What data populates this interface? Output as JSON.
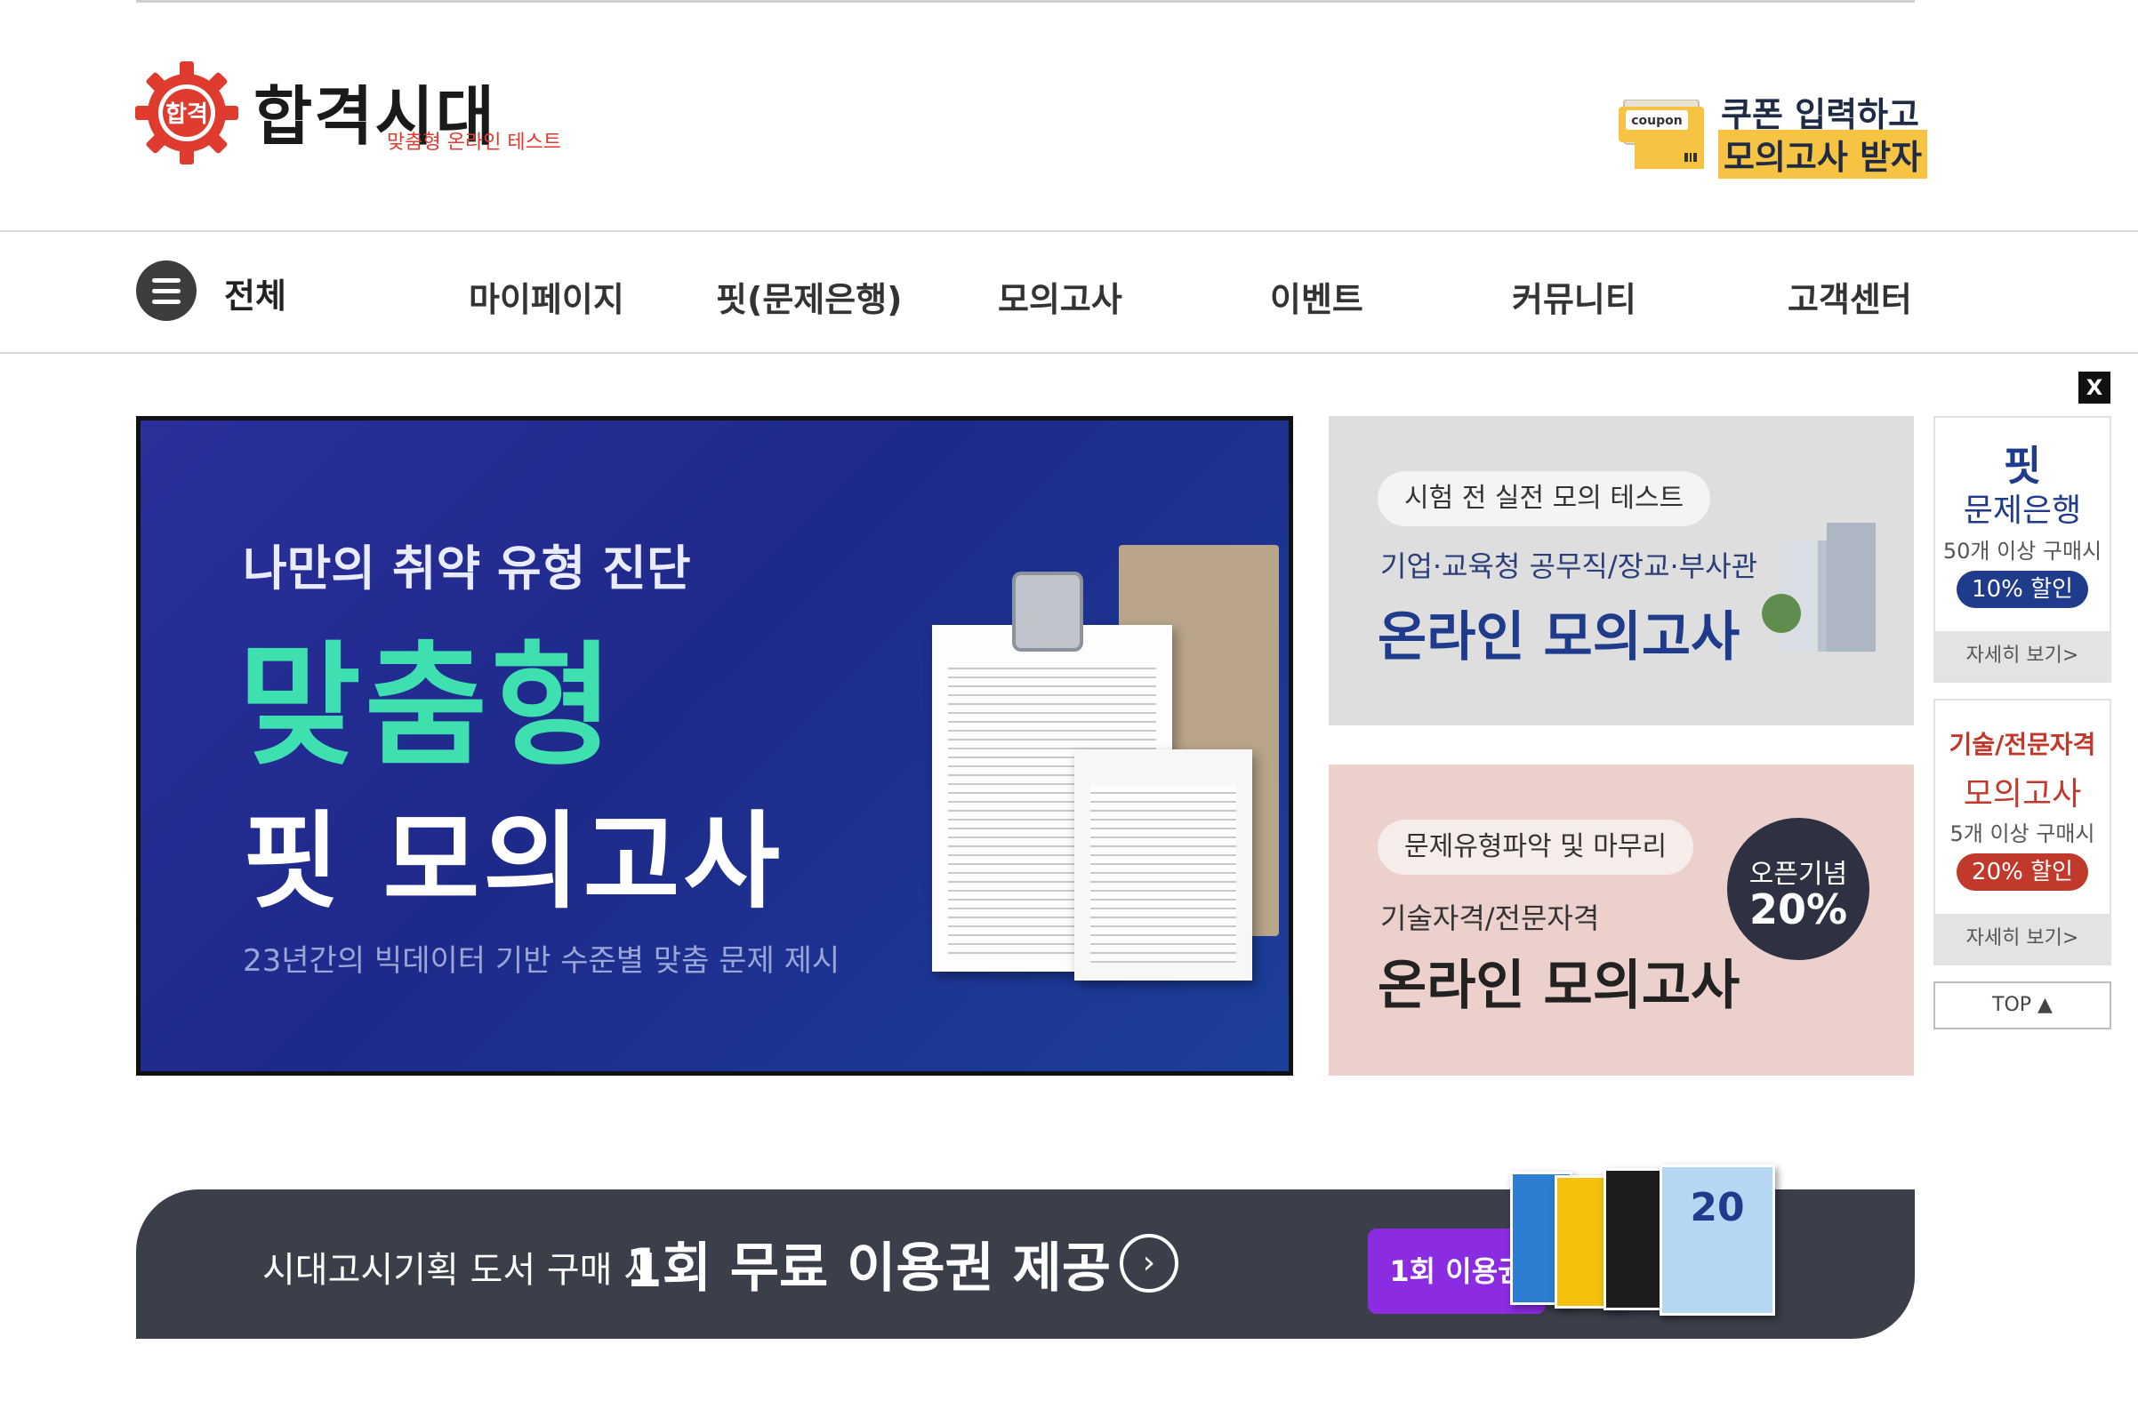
{
  "header": {
    "logo_mark": "합격",
    "logo_title": "합격시대",
    "logo_subtitle": "맞춤형 온라인 테스트",
    "coupon": {
      "tag": "coupon",
      "line1": "쿠폰 입력하고",
      "line2": "모의고사 받자"
    }
  },
  "nav": {
    "all_label": "전체",
    "items": [
      "마이페이지",
      "핏(문제은행)",
      "모의고사",
      "이벤트",
      "커뮤니티",
      "고객센터"
    ]
  },
  "main_banner": {
    "line1": "나만의 취약 유형 진단",
    "line2": "맞춤형",
    "line3": "핏 모의고사",
    "line4": "23년간의 빅데이터 기반 수준별 맞춤 문제 제시"
  },
  "side_banners": [
    {
      "pill": "시험 전 실전 모의 테스트",
      "sub": "기업·교육청 공무직/장교·부사관",
      "main": "온라인 모의고사"
    },
    {
      "pill": "문제유형파악 및 마무리",
      "sub": "기술자격/전문자격",
      "main": "온라인 모의고사",
      "circle_line1": "오픈기념",
      "circle_line2": "20%"
    }
  ],
  "close_label": "X",
  "quick_cards": [
    {
      "big": "핏",
      "title": "문제은행",
      "condition": "50개 이상 구매시",
      "badge": "10% 할인",
      "more": "자세히 보기>"
    },
    {
      "title_small": "기술/전문자격",
      "title": "모의고사",
      "condition": "5개 이상 구매시",
      "badge": "20% 할인",
      "more": "자세히 보기>"
    }
  ],
  "top_button": "TOP ▲",
  "bottom_banner": {
    "text1": "시대고시기획 도서 구매 시",
    "text2": "1회 무료 이용권 제공",
    "arrow": "›",
    "ticket": "1회 이용권",
    "book_label": "20"
  },
  "colors": {
    "brand_red": "#e03b2f",
    "navy": "#1f3b8c",
    "mint": "#3fe0b0",
    "coupon_yellow": "#f6c343",
    "ticket_purple": "#8b2be2"
  }
}
